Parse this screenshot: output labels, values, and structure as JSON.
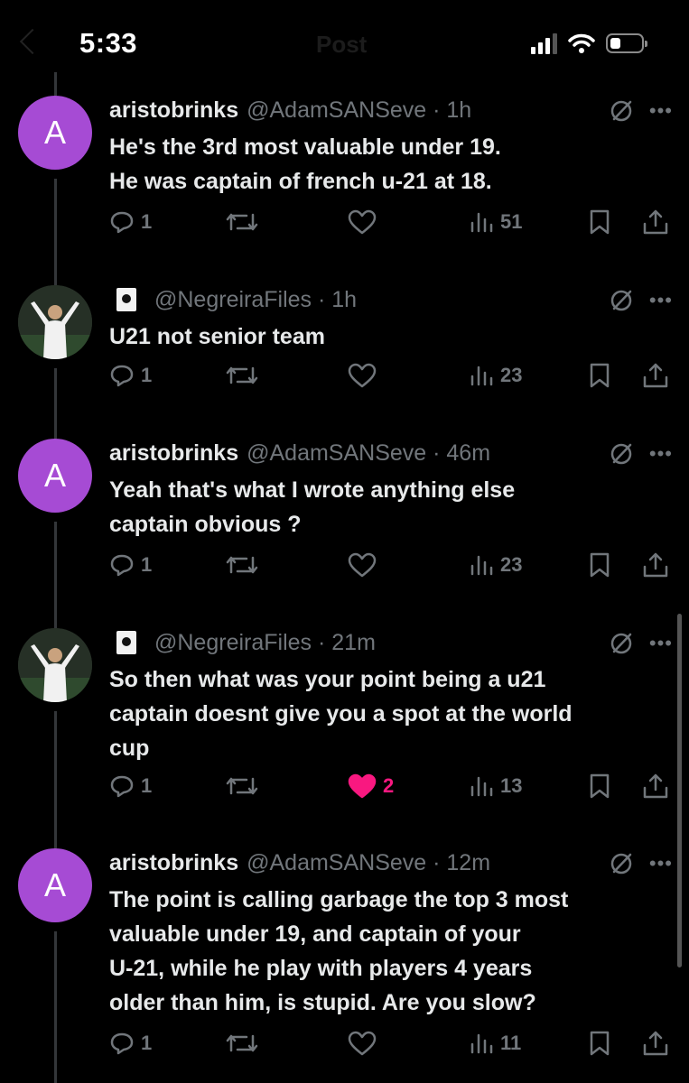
{
  "status_bar": {
    "time": "5:33",
    "header_title": "Post",
    "icons": [
      "signal-icon",
      "wifi-icon",
      "battery-icon"
    ]
  },
  "colors": {
    "background": "#000000",
    "text": "#e7e9ea",
    "muted": "#71767b",
    "avatar_purple": "#a64bd4",
    "like_pink": "#f91880"
  },
  "tweets": [
    {
      "avatar": "A",
      "name": "aristobrinks",
      "handle": "@AdamSANSeve",
      "time": "· 1h",
      "text": "He's the 3rd most valuable under 19.\nHe was captain of french u-21 at 18.",
      "replies": "1",
      "likes": "",
      "liked": false,
      "views": "51"
    },
    {
      "avatar": "",
      "name": "",
      "handle": "@NegreiraFiles",
      "time": "· 1h",
      "text": "U21 not senior team",
      "replies": "1",
      "likes": "",
      "liked": false,
      "views": "23"
    },
    {
      "avatar": "A",
      "name": "aristobrinks",
      "handle": "@AdamSANSeve",
      "time": "· 46m",
      "text": "Yeah that's what I wrote anything else\ncaptain obvious ?",
      "replies": "1",
      "likes": "",
      "liked": false,
      "views": "23"
    },
    {
      "avatar": "",
      "name": "",
      "handle": "@NegreiraFiles",
      "time": "· 21m",
      "text": "So then what was your point being a u21\ncaptain doesnt give you a spot at the world\ncup",
      "replies": "1",
      "likes": "2",
      "liked": true,
      "views": "13"
    },
    {
      "avatar": "A",
      "name": "aristobrinks",
      "handle": "@AdamSANSeve",
      "time": "· 12m",
      "text": "The point is calling garbage the top 3 most\nvaluable under 19, and captain of your\nU-21, while he play with players 4 years\nolder than him, is stupid. Are you slow?",
      "replies": "1",
      "likes": "",
      "liked": false,
      "views": "11"
    }
  ]
}
